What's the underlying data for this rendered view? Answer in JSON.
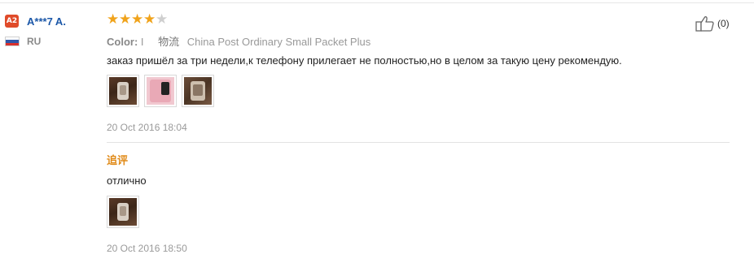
{
  "buyer": {
    "badge": "A2",
    "name": "A***7 A.",
    "country": "RU",
    "flag_colors": [
      "#ffffff",
      "#3056a8",
      "#d9302c"
    ]
  },
  "review": {
    "rating": 4,
    "max_rating": 5,
    "star_color": "#f0a31b",
    "star_empty_color": "#cfcfcf",
    "color_label": "Color:",
    "color_value": "I",
    "shipping_label": "物流",
    "shipping_value": "China Post Ordinary Small Packet Plus",
    "text": "заказ пришёл за три недели,к телефону прилегает не полностью,но в целом за такую цену рекомендую.",
    "photos": [
      "photo-phone-case-1",
      "photo-phone-case-pink",
      "photo-phone-case-3"
    ],
    "date": "20 Oct 2016 18:04"
  },
  "followup": {
    "label": "追评",
    "text": "отлично",
    "photos": [
      "photo-phone-case-followup"
    ],
    "date": "20 Oct 2016 18:50"
  },
  "helpful": {
    "icon": "thumbs-up-icon",
    "count": "(0)"
  }
}
